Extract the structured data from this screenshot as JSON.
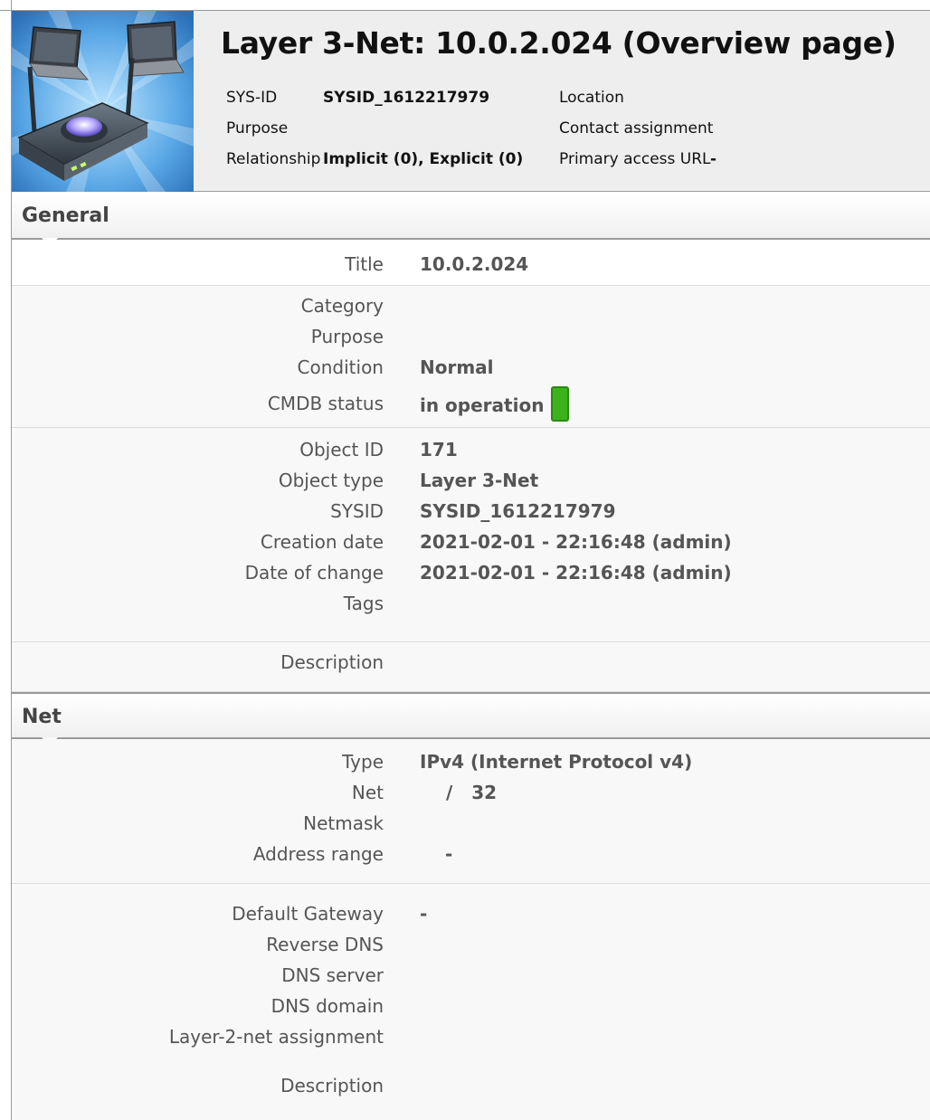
{
  "header": {
    "title": "Layer 3-Net: 10.0.2.024 (Overview page)",
    "sys_id_label": "SYS-ID",
    "sys_id_value": "SYSID_1612217979",
    "purpose_label": "Purpose",
    "relationship_label": "Relationship",
    "relationship_value": "Implicit (0), Explicit (0)",
    "location_label": "Location",
    "contact_label": "Contact assignment",
    "access_url_label": "Primary access URL",
    "access_url_value": "-"
  },
  "general": {
    "section_title": "General",
    "title_label": "Title",
    "title_value": "10.0.2.024",
    "category_label": "Category",
    "purpose_label": "Purpose",
    "condition_label": "Condition",
    "condition_value": "Normal",
    "cmdb_status_label": "CMDB status",
    "cmdb_status_value": "in operation",
    "cmdb_status_color": "#3cb31a",
    "object_id_label": "Object ID",
    "object_id_value": "171",
    "object_type_label": "Object type",
    "object_type_value": "Layer 3-Net",
    "sysid_label": "SYSID",
    "sysid_value": "SYSID_1612217979",
    "creation_date_label": "Creation date",
    "creation_date_value": "2021-02-01 - 22:16:48 (admin)",
    "change_date_label": "Date of change",
    "change_date_value": "2021-02-01 - 22:16:48 (admin)",
    "tags_label": "Tags",
    "description_label": "Description"
  },
  "net": {
    "section_title": "Net",
    "type_label": "Type",
    "type_value": "IPv4 (Internet Protocol v4)",
    "net_label": "Net",
    "net_value": "/   32",
    "netmask_label": "Netmask",
    "address_range_label": "Address range",
    "address_range_value": "-",
    "gateway_label": "Default Gateway",
    "gateway_value": "-",
    "reverse_dns_label": "Reverse DNS",
    "dns_server_label": "DNS server",
    "dns_domain_label": "DNS domain",
    "layer2_label": "Layer-2-net assignment",
    "description_label": "Description"
  }
}
